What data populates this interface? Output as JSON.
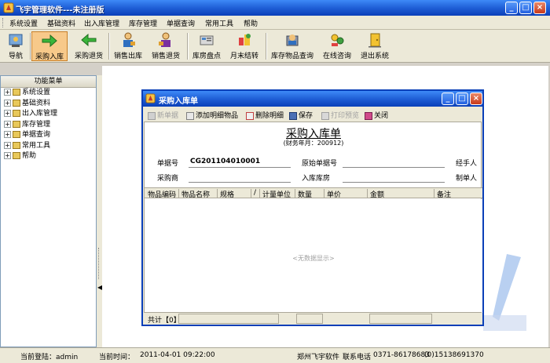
{
  "window": {
    "title": "飞宇管理软件---未注册版"
  },
  "menu": [
    "系统设置",
    "基础资料",
    "出入库管理",
    "库存管理",
    "单据查询",
    "常用工具",
    "帮助"
  ],
  "toolbar": [
    {
      "label": "导航",
      "icon": "navigation-icon"
    },
    {
      "label": "采购入库",
      "icon": "purchase-in-icon",
      "active": true
    },
    {
      "label": "采购退货",
      "icon": "purchase-return-icon"
    },
    {
      "label": "销售出库",
      "icon": "sales-out-icon"
    },
    {
      "label": "销售退货",
      "icon": "sales-return-icon"
    },
    {
      "label": "库房盘点",
      "icon": "stocktake-icon"
    },
    {
      "label": "月末结转",
      "icon": "month-end-icon"
    },
    {
      "label": "库存物品查询",
      "icon": "inventory-query-icon"
    },
    {
      "label": "在线咨询",
      "icon": "online-chat-icon"
    },
    {
      "label": "退出系统",
      "icon": "exit-icon"
    }
  ],
  "sidebar": {
    "header": "功能菜单",
    "items": [
      "系统设置",
      "基础资料",
      "出入库管理",
      "库存管理",
      "单据查询",
      "常用工具",
      "帮助"
    ]
  },
  "status": {
    "user_label": "当前登陆：admin",
    "time_label": "当前时间：",
    "time_value": "2011-04-01  09:22:00",
    "company": "郑州飞宇软件",
    "contact_label": "联系电话",
    "phone": "0371-86178683",
    "mobile": "(0)15138691370"
  },
  "dialog": {
    "title": "采购入库单",
    "toolbar": [
      {
        "label": "新单据",
        "disabled": true
      },
      {
        "label": "添加明细物品",
        "disabled": false
      },
      {
        "label": "删除明细",
        "disabled": false
      },
      {
        "label": "保存",
        "disabled": false
      },
      {
        "label": "打印预览",
        "disabled": true
      },
      {
        "label": "关闭",
        "disabled": false
      }
    ],
    "form_title": "采购入库单",
    "fiscal_month": "(财务年月：200912)",
    "fields": {
      "doc_no_label": "单据号",
      "doc_no_value": "CG201104010001",
      "orig_no_label": "原始单据号",
      "handler_label": "经手人",
      "supplier_label": "采购商",
      "warehouse_label": "入库库房",
      "creator_label": "制单人"
    },
    "columns": [
      "物品编码",
      "物品名称",
      "规格",
      "/",
      "计量单位",
      "数量",
      "单价",
      "金额",
      "备注"
    ],
    "empty_text": "<无数据显示>",
    "footer_total": "共计【0】"
  }
}
